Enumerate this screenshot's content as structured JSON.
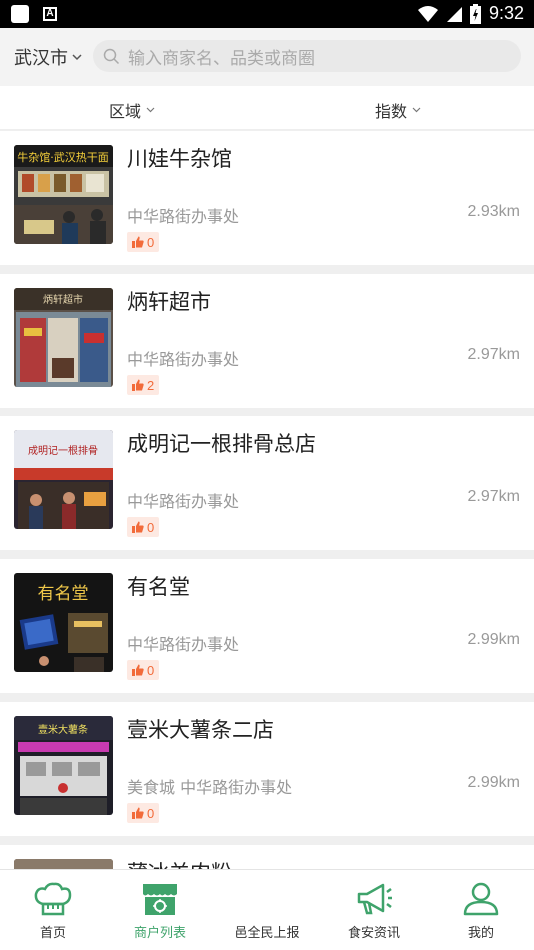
{
  "status_bar": {
    "time": "9:32"
  },
  "header": {
    "city": "武汉市",
    "search_placeholder": "输入商家名、品类或商圈"
  },
  "filters": [
    {
      "label": "区域"
    },
    {
      "label": "指数"
    }
  ],
  "merchants": [
    {
      "name": "川娃牛杂馆",
      "address": "中华路街办事处",
      "distance": "2.93km",
      "likes": "0"
    },
    {
      "name": "炳轩超市",
      "address": "中华路街办事处",
      "distance": "2.97km",
      "likes": "2"
    },
    {
      "name": "成明记一根排骨总店",
      "address": "中华路街办事处",
      "distance": "2.97km",
      "likes": "0"
    },
    {
      "name": "有名堂",
      "address": "中华路街办事处",
      "distance": "2.99km",
      "likes": "0"
    },
    {
      "name": "壹米大薯条二店",
      "address": "美食城   中华路街办事处",
      "distance": "2.99km",
      "likes": "0"
    },
    {
      "name": "蒲冰羊肉粉",
      "address": "",
      "distance": "",
      "likes": ""
    }
  ],
  "thumbnail_signs": [
    "牛杂馆·武汉热干面",
    "炳轩超市",
    "成明记一根排骨",
    "有名堂",
    "壹米大薯条"
  ],
  "bottom_nav": [
    {
      "label": "首页",
      "icon": "chef-hat-icon"
    },
    {
      "label": "商户列表",
      "icon": "shop-icon"
    },
    {
      "label": "邑全民上报",
      "icon": "report-icon"
    },
    {
      "label": "食安资讯",
      "icon": "megaphone-icon"
    },
    {
      "label": "我的",
      "icon": "user-icon"
    }
  ],
  "colors": {
    "accent_green": "#3fa36b",
    "like_orange": "#f26b3a",
    "like_bg": "#fde9e2"
  }
}
